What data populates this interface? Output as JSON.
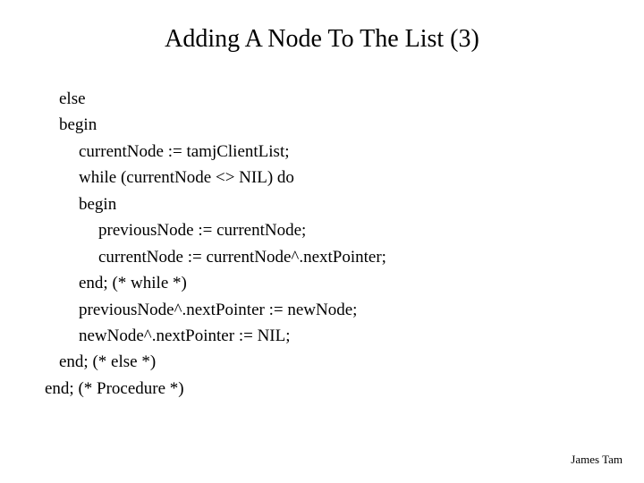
{
  "title": "Adding A Node To The List (3)",
  "lines": [
    {
      "indent": 0,
      "text": "else"
    },
    {
      "indent": 0,
      "text": "begin"
    },
    {
      "indent": 1,
      "text": "currentNode := tamjClientList;"
    },
    {
      "indent": 1,
      "text": "while (currentNode <> NIL) do"
    },
    {
      "indent": 1,
      "text": "begin"
    },
    {
      "indent": 2,
      "text": "previousNode := currentNode;"
    },
    {
      "indent": 2,
      "text": "currentNode := currentNode^.nextPointer;"
    },
    {
      "indent": 1,
      "text": "end; (* while *)"
    },
    {
      "indent": 1,
      "text": "previousNode^.nextPointer := newNode;"
    },
    {
      "indent": 1,
      "text": "newNode^.nextPointer := NIL;"
    },
    {
      "indent": 0,
      "text": "end; (* else *)"
    }
  ],
  "closing": "end; (* Procedure *)",
  "footer": "James Tam"
}
